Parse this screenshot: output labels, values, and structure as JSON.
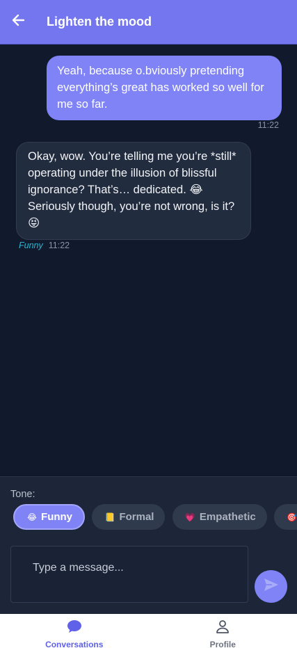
{
  "header": {
    "title": "Lighten the mood",
    "back_icon": "arrow-left-icon"
  },
  "messages": [
    {
      "sender": "user",
      "text": "Yeah, because o.bviously pretending everything’s great has worked so well for me so far.",
      "time": "11:22"
    },
    {
      "sender": "bot",
      "text": "Okay, wow. You’re telling me you’re *still* operating under the illusion of blissful ignorance? That’s… dedicated. 😂 Seriously though, you’re not wrong, is it? 😝",
      "tone": "Funny",
      "time": "11:22"
    }
  ],
  "tone_panel": {
    "label": "Tone:",
    "chips": [
      {
        "emoji": "😂",
        "label": "Funny",
        "active": true
      },
      {
        "emoji": "📒",
        "label": "Formal",
        "active": false
      },
      {
        "emoji": "💗",
        "label": "Empathetic",
        "active": false
      },
      {
        "emoji": "🎯",
        "label": "",
        "active": false
      }
    ]
  },
  "composer": {
    "placeholder": "Type a message...",
    "send_icon": "send-icon"
  },
  "bottom_nav": [
    {
      "label": "Conversations",
      "icon": "chat-bubble-icon",
      "active": true
    },
    {
      "label": "Profile",
      "icon": "user-icon",
      "active": false
    }
  ],
  "colors": {
    "accent": "#7f83f6",
    "header": "#7476ef",
    "background": "#111a2c",
    "tone_tag": "#24b8d6"
  }
}
